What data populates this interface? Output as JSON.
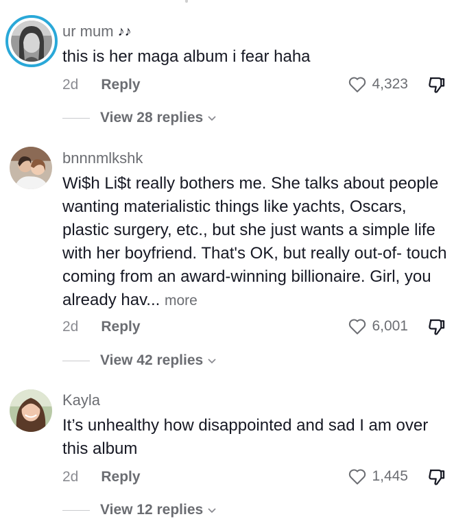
{
  "comments": [
    {
      "username": "ur mum",
      "username_suffix": "♪♪",
      "text": "this is her maga album i fear haha",
      "more": "",
      "time": "2d",
      "reply_label": "Reply",
      "likes": "4,323",
      "view_replies": "View 28 replies"
    },
    {
      "username": "bnnnmlkshk",
      "text": "Wi$h Li$t really bothers me. She talks about people wanting materialistic things like yachts, Oscars, plastic surgery, etc., but she just wants a simple life with her boyfriend. That's OK, but really out-of- touch coming from an award-winning billionaire. Girl, you already hav...",
      "more": "more",
      "time": "2d",
      "reply_label": "Reply",
      "likes": "6,001",
      "view_replies": "View 42 replies"
    },
    {
      "username": "Kayla",
      "text": "It’s unhealthy how disappointed and sad I am over this album",
      "more": "",
      "time": "2d",
      "reply_label": "Reply",
      "likes": "1,445",
      "view_replies": "View 12 replies"
    }
  ],
  "icons": {
    "like": "heart-outline-icon",
    "dislike": "thumbs-down-outline-icon",
    "chevron": "chevron-down-icon",
    "music": "music-notes-icon"
  },
  "colors": {
    "avatar_ring": "#2aa8d8",
    "username": "#6b6d72",
    "body_text": "#161823",
    "meta_text": "#8a8b91"
  }
}
